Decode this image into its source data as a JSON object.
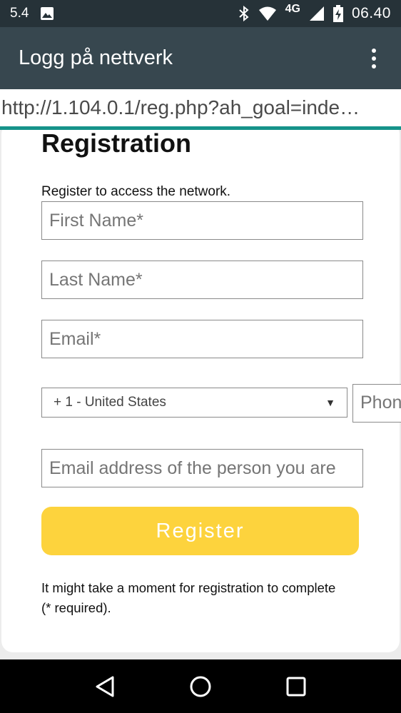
{
  "status_bar": {
    "left_text": "5.4",
    "network_type": "4G",
    "time": "06.40",
    "icons": [
      "image-notification-icon",
      "bluetooth-icon",
      "wifi-icon",
      "signal-icon",
      "battery-charging-icon"
    ]
  },
  "app_bar": {
    "title": "Logg på nettverk",
    "menu_icon": "more-vert-icon"
  },
  "url_bar": {
    "url": "http://1.104.0.1/reg.php?ah_goal=inde…"
  },
  "form": {
    "title": "Registration",
    "subtitle": "Register to access the network.",
    "first_name_placeholder": "First Name*",
    "last_name_placeholder": "Last Name*",
    "email_placeholder": "Email*",
    "country_selected": "+ 1 - United States",
    "phone_placeholder": "Phon",
    "sponsor_placeholder": "Email address of the person you are",
    "register_label": "Register",
    "note": "It might take a moment for registration to complete (* required)."
  },
  "nav_bar": {
    "icons": [
      "back-icon",
      "home-icon",
      "recents-icon"
    ]
  },
  "colors": {
    "status_bar_bg": "#263238",
    "app_bar_bg": "#37474f",
    "accent": "#16938a",
    "button_bg": "#fdd33d"
  }
}
